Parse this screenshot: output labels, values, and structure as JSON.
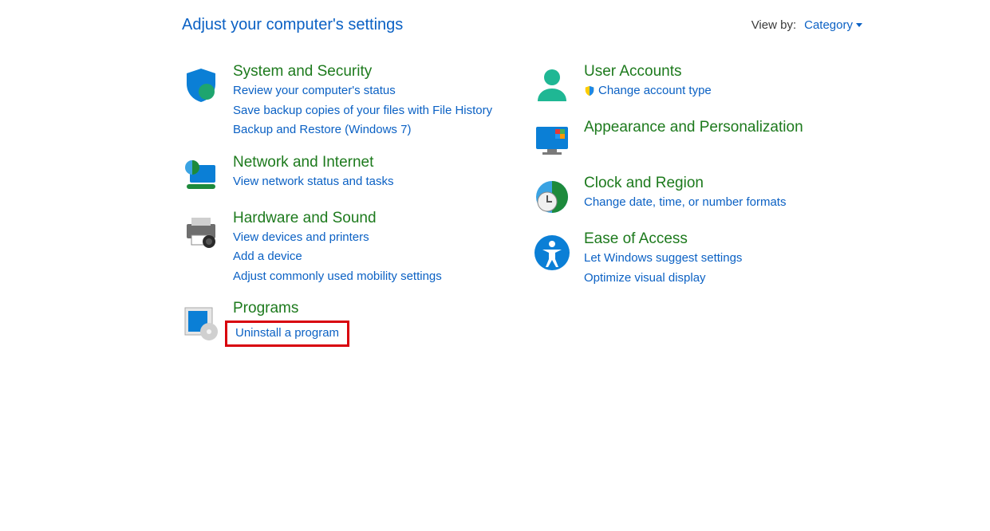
{
  "header": {
    "title": "Adjust your computer's settings",
    "view_by_label": "View by:",
    "view_by_value": "Category"
  },
  "left": [
    {
      "id": "system-security",
      "title": "System and Security",
      "icon": "shield-icon",
      "links": [
        "Review your computer's status",
        "Save backup copies of your files with File History",
        "Backup and Restore (Windows 7)"
      ]
    },
    {
      "id": "network-internet",
      "title": "Network and Internet",
      "icon": "network-icon",
      "links": [
        "View network status and tasks"
      ]
    },
    {
      "id": "hardware-sound",
      "title": "Hardware and Sound",
      "icon": "printer-icon",
      "links": [
        "View devices and printers",
        "Add a device",
        "Adjust commonly used mobility settings"
      ]
    },
    {
      "id": "programs",
      "title": "Programs",
      "icon": "programs-icon",
      "links": [
        "Uninstall a program"
      ],
      "highlight": true
    }
  ],
  "right": [
    {
      "id": "user-accounts",
      "title": "User Accounts",
      "icon": "user-icon",
      "links": [
        "Change account type"
      ],
      "shield_on_first": true
    },
    {
      "id": "appearance",
      "title": "Appearance and Personalization",
      "icon": "appearance-icon",
      "links": []
    },
    {
      "id": "clock-region",
      "title": "Clock and Region",
      "icon": "clock-icon",
      "links": [
        "Change date, time, or number formats"
      ]
    },
    {
      "id": "ease-of-access",
      "title": "Ease of Access",
      "icon": "ease-icon",
      "links": [
        "Let Windows suggest settings",
        "Optimize visual display"
      ]
    }
  ]
}
